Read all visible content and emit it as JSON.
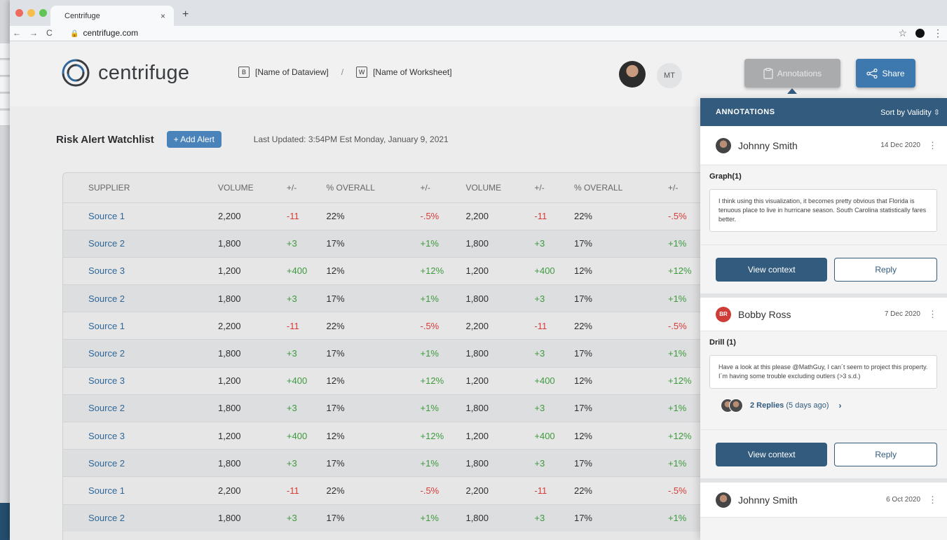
{
  "browser": {
    "tab_title": "Centrifuge",
    "tab_close": "×",
    "new_tab": "+",
    "url": "centrifuge.com",
    "back": "←",
    "forward": "→",
    "reload": "C",
    "star": "☆",
    "menu": "⋮"
  },
  "header": {
    "logo_text": "centrifuge",
    "dataview": "[Name of Dataview]",
    "dataview_icon": "B",
    "separator": "/",
    "worksheet": "[Name of Worksheet]",
    "worksheet_icon": "W",
    "user_initials": "MT",
    "annotations_label": "Annotations",
    "share_label": "Share"
  },
  "watchlist": {
    "title": "Risk Alert Watchlist",
    "add_alert": "+ Add Alert",
    "last_updated": "Last Updated: 3:54PM Est Monday, January 9, 2021"
  },
  "table": {
    "headers": [
      "SUPPLIER",
      "VOLUME",
      "+/-",
      "% OVERALL",
      "+/-",
      "VOLUME",
      "+/-",
      "% OVERALL",
      "+/-"
    ],
    "rows": [
      [
        "Source 1",
        "2,200",
        "-11",
        "22%",
        "-.5%",
        "2,200",
        "-11",
        "22%",
        "-.5%"
      ],
      [
        "Source 2",
        "1,800",
        "+3",
        "17%",
        "+1%",
        "1,800",
        "+3",
        "17%",
        "+1%"
      ],
      [
        "Source 3",
        "1,200",
        "+400",
        "12%",
        "+12%",
        "1,200",
        "+400",
        "12%",
        "+12%"
      ],
      [
        "Source 2",
        "1,800",
        "+3",
        "17%",
        "+1%",
        "1,800",
        "+3",
        "17%",
        "+1%"
      ],
      [
        "Source 1",
        "2,200",
        "-11",
        "22%",
        "-.5%",
        "2,200",
        "-11",
        "22%",
        "-.5%"
      ],
      [
        "Source 2",
        "1,800",
        "+3",
        "17%",
        "+1%",
        "1,800",
        "+3",
        "17%",
        "+1%"
      ],
      [
        "Source 3",
        "1,200",
        "+400",
        "12%",
        "+12%",
        "1,200",
        "+400",
        "12%",
        "+12%"
      ],
      [
        "Source 2",
        "1,800",
        "+3",
        "17%",
        "+1%",
        "1,800",
        "+3",
        "17%",
        "+1%"
      ],
      [
        "Source 3",
        "1,200",
        "+400",
        "12%",
        "+12%",
        "1,200",
        "+400",
        "12%",
        "+12%"
      ],
      [
        "Source 2",
        "1,800",
        "+3",
        "17%",
        "+1%",
        "1,800",
        "+3",
        "17%",
        "+1%"
      ],
      [
        "Source 1",
        "2,200",
        "-11",
        "22%",
        "-.5%",
        "2,200",
        "-11",
        "22%",
        "-.5%"
      ],
      [
        "Source 2",
        "1,800",
        "+3",
        "17%",
        "+1%",
        "1,800",
        "+3",
        "17%",
        "+1%"
      ]
    ]
  },
  "annotations_panel": {
    "title": "ANNOTATIONS",
    "sort_label": "Sort by Validity",
    "sort_icon": "⌃⌄",
    "cards": [
      {
        "author": "Johnny Smith",
        "date": "14 Dec 2020",
        "label": "Graph(1)",
        "text": "I think using this visualization, it becomes pretty obvious that Florida is tenuous place to live in hurricane season. South Carolina statistically fares better.",
        "view_context": "View context",
        "reply": "Reply"
      },
      {
        "author": "Bobby Ross",
        "initials": "BR",
        "date": "7 Dec 2020",
        "label": "Drill (1)",
        "text": "Have a look at this please @MathGuy, I can´t seem to project this property. I´m having some trouble excluding outlers (>3 s.d.)",
        "replies_count": "2 Replies",
        "replies_time": "(5 days ago)",
        "view_context": "View context",
        "reply": "Reply"
      },
      {
        "author": "Johnny Smith",
        "date": "6 Oct 2020"
      }
    ]
  },
  "colors": {
    "accent": "#325b7d",
    "supplier_link": "#2e6799",
    "negative": "#d73b36",
    "positive": "#3d9a3d"
  }
}
